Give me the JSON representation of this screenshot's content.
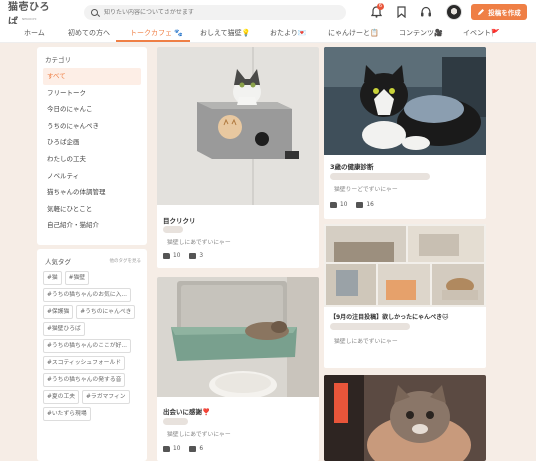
{
  "header": {
    "logo": "猫壱ひろば",
    "logo_sub": "NEKOICHI",
    "search_placeholder": "知りたい内容についてさがせます",
    "notification_count": "6",
    "post_button": "投稿を作成"
  },
  "nav": {
    "items": [
      "ホーム",
      "初めての方へ",
      "トークカフェ",
      "おしえて猫壁",
      "おたより",
      "にゃんけーと",
      "コンテンツ",
      "イベント"
    ]
  },
  "sidebar": {
    "category_title": "カテゴリ",
    "categories": [
      "すべて",
      "フリートーク",
      "今日のにゃんこ",
      "うちのにゃんぺき",
      "ひろば企画",
      "わたしの工夫",
      "ノベルティ",
      "猫ちゃんの体調管理",
      "気軽にひとこと",
      "自己紹介・猫紹介"
    ],
    "tags_title": "人気タグ",
    "tags_more": "他のタグを見る",
    "tags": [
      "#猫",
      "#猫壁",
      "#うちの猫ちゃんのお気に入...",
      "#保護猫",
      "#うちのにゃんぺき",
      "#猫壁ひろば",
      "#うちの猫ちゃんのここが好...",
      "#スコティッシュフォールド",
      "#うちの猫ちゃんの発する音",
      "#夏の工夫",
      "#ラガマフィン",
      "#いたずら現場"
    ]
  },
  "cards": [
    {
      "title": "目クリクリ",
      "desc": "猫壁しにあでずいにゃー",
      "likes": "10",
      "comments": "3"
    },
    {
      "title": "3歳の健康診断",
      "desc": "猫壁りーどでずいにゃー",
      "likes": "10",
      "comments": "16"
    },
    {
      "title": "出会いに感謝❣️",
      "desc": "猫壁しにあでずいにゃー",
      "likes": "10",
      "comments": "6"
    },
    {
      "title": "【9月の注目投稿】欲しかったにゃんぺき🐱",
      "desc": "猫壁しにあでずいにゃー",
      "likes": "",
      "comments": ""
    }
  ],
  "colors": {
    "accent": "#ef7f45",
    "background": "#f6ede6"
  }
}
